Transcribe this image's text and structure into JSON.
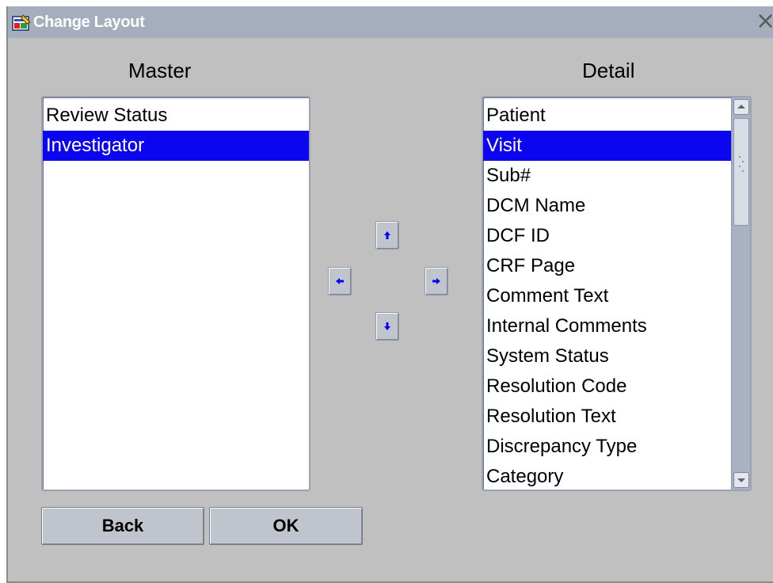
{
  "window": {
    "title": "Change Layout"
  },
  "master": {
    "label": "Master",
    "items": [
      "Review Status",
      "Investigator"
    ],
    "selected": "Investigator"
  },
  "detail": {
    "label": "Detail",
    "items": [
      "Patient",
      "Visit",
      "Sub#",
      "DCM Name",
      "DCF ID",
      "CRF Page",
      "Comment Text",
      "Internal Comments",
      "System Status",
      "Resolution Code",
      "Resolution Text",
      "Discrepancy Type",
      "Category"
    ],
    "selected": "Visit"
  },
  "buttons": {
    "back": "Back",
    "ok": "OK"
  },
  "colors": {
    "selection": "#0c05f0",
    "titlebar": "#a5aebd",
    "arrow": "#0000ff"
  }
}
